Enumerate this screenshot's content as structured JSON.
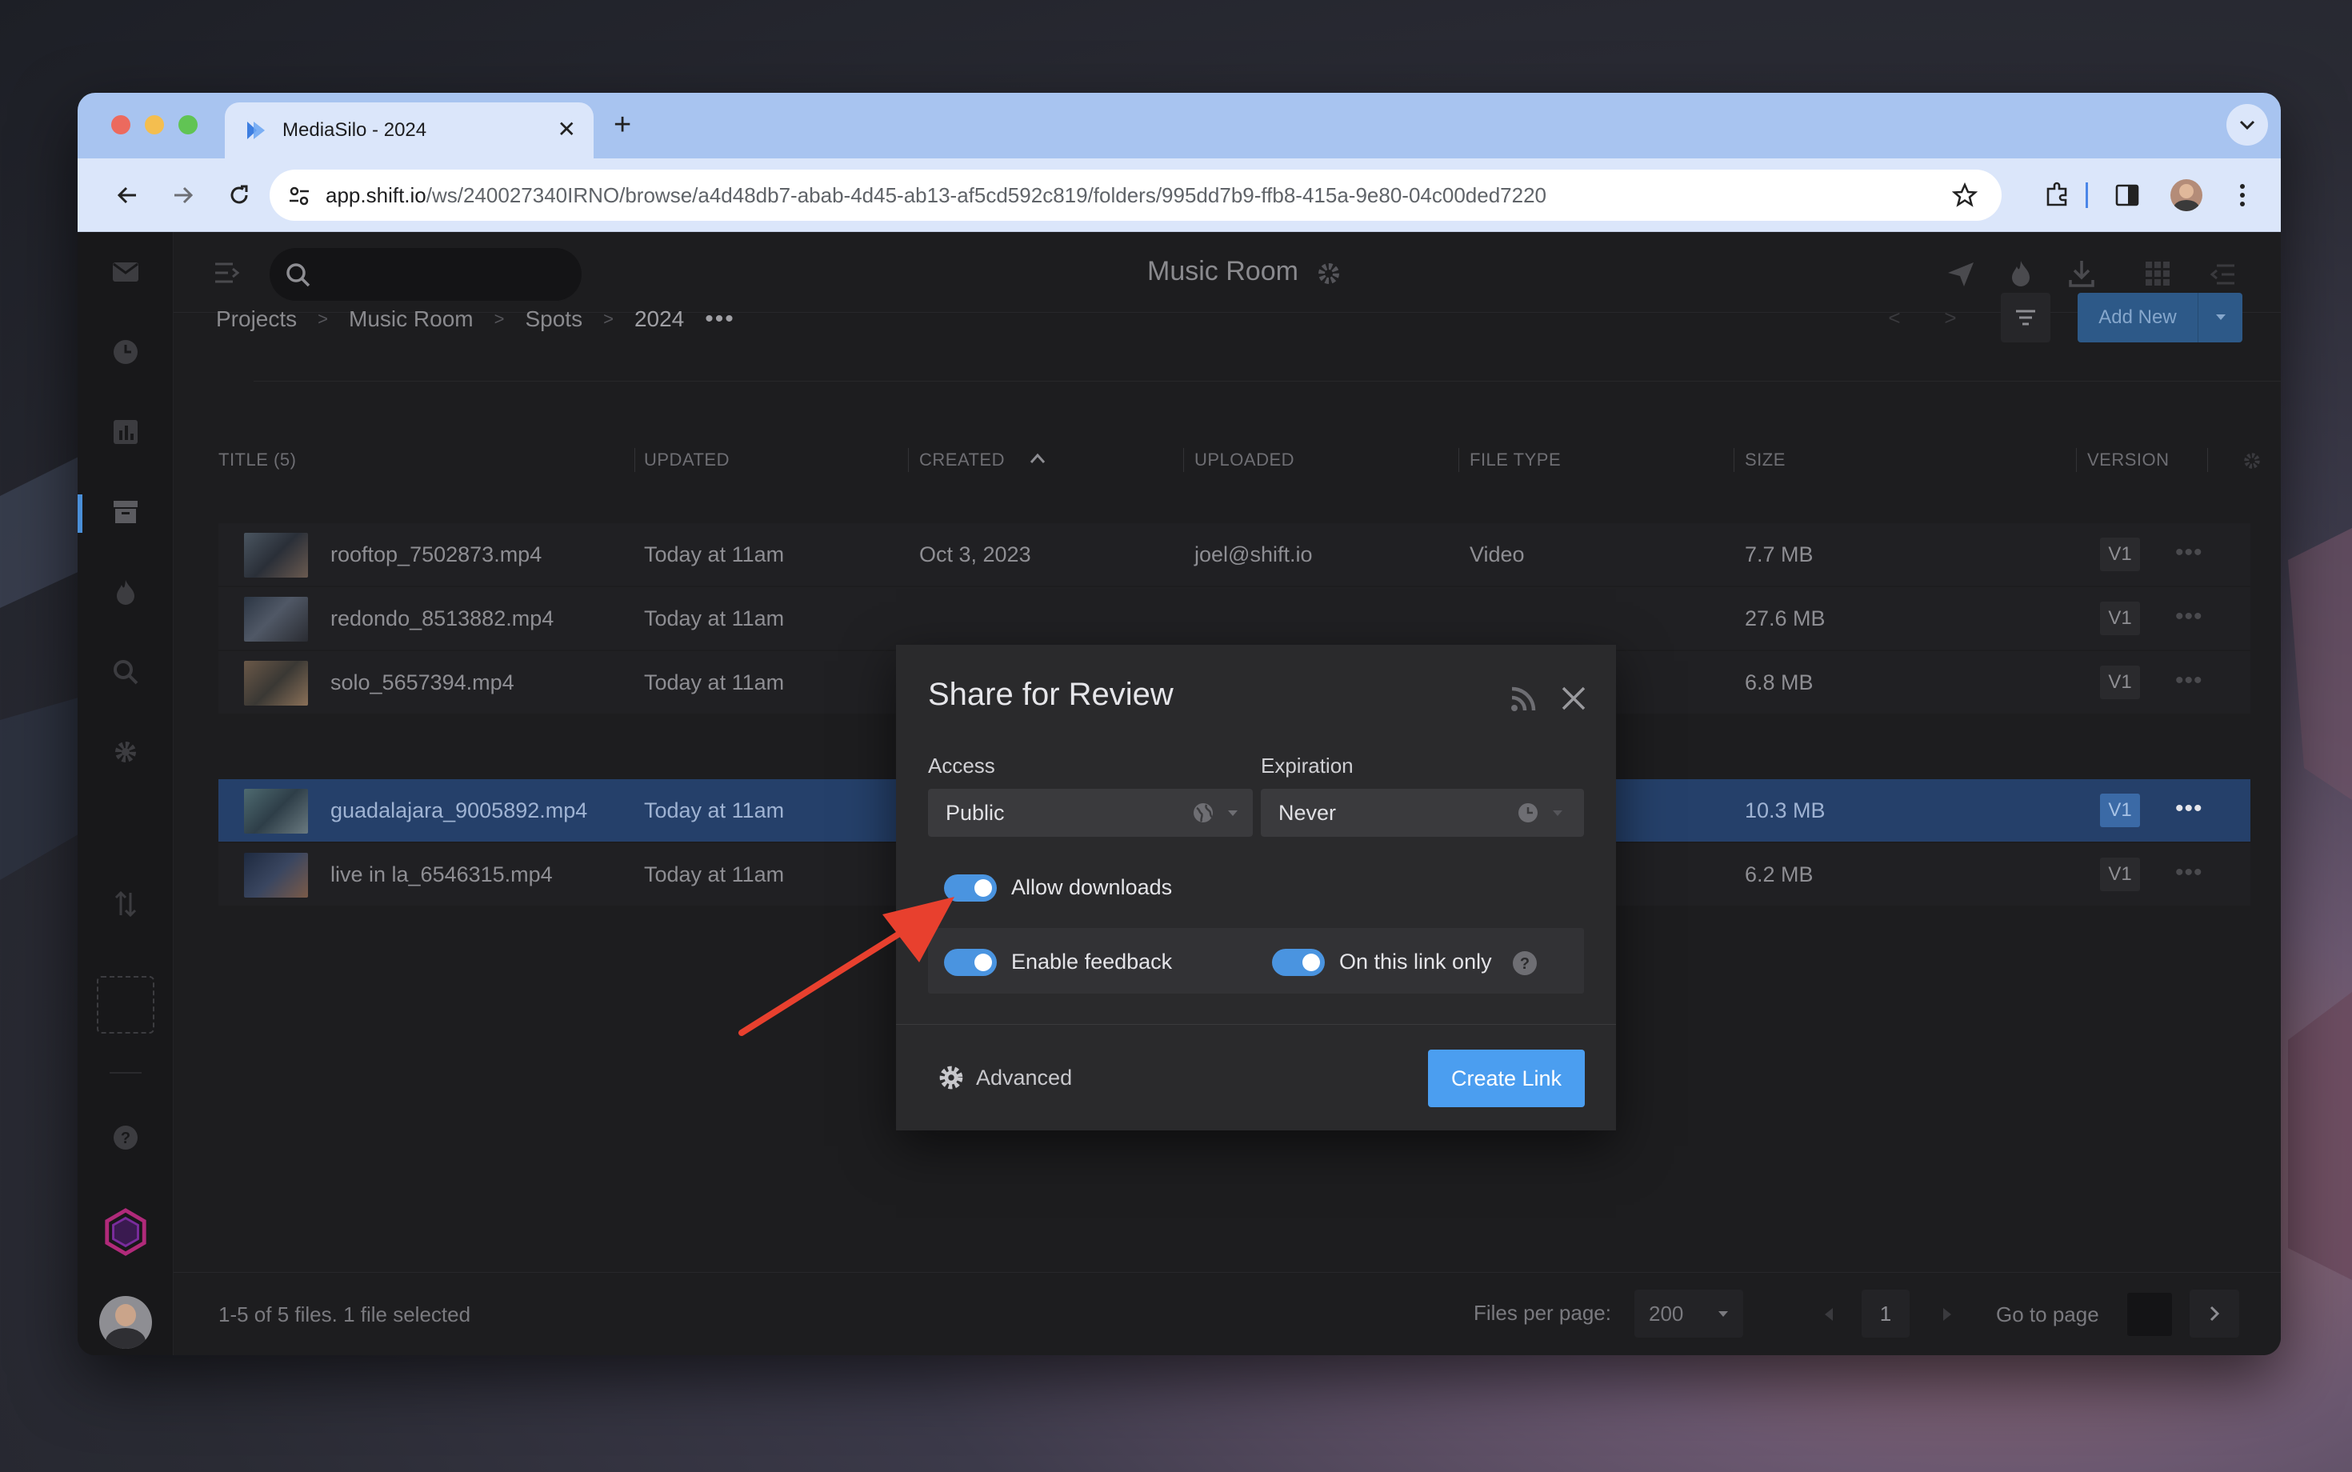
{
  "browser": {
    "tab_title": "MediaSilo - 2024",
    "url_host": "app.shift.io",
    "url_path": "/ws/240027340IRNO/browse/a4d48db7-abab-4d45-ab13-af5cd592c819/folders/995dd7b9-ffb8-415a-9e80-04c00ded7220"
  },
  "header": {
    "room_title": "Music Room"
  },
  "breadcrumb": [
    "Projects",
    "Music Room",
    "Spots",
    "2024"
  ],
  "toolbar": {
    "add_new_label": "Add New"
  },
  "table": {
    "columns": [
      "TITLE (5)",
      "UPDATED",
      "CREATED",
      "UPLOADED",
      "FILE TYPE",
      "SIZE",
      "VERSION"
    ],
    "rows": [
      {
        "title": "rooftop_7502873.mp4",
        "updated": "Today at 11am",
        "created": "Oct 3, 2023",
        "uploaded": "joel@shift.io",
        "type": "Video",
        "size": "7.7 MB",
        "version": "V1"
      },
      {
        "title": "redondo_8513882.mp4",
        "updated": "Today at 11am",
        "size": "27.6 MB",
        "version": "V1"
      },
      {
        "title": "solo_5657394.mp4",
        "updated": "Today at 11am",
        "size": "6.8 MB",
        "version": "V1"
      },
      {
        "title": "guadalajara_9005892.mp4",
        "updated": "Today at 11am",
        "size": "10.3 MB",
        "version": "V1"
      },
      {
        "title": "live in la_6546315.mp4",
        "updated": "Today at 11am",
        "size": "6.2 MB",
        "version": "V1"
      }
    ]
  },
  "footer": {
    "status": "1-5 of 5 files. 1 file selected",
    "per_page_label": "Files per page:",
    "per_page_value": "200",
    "page": "1",
    "goto_label": "Go to page"
  },
  "modal": {
    "title": "Share for Review",
    "access_label": "Access",
    "access_value": "Public",
    "expiration_label": "Expiration",
    "expiration_value": "Never",
    "allow_downloads_label": "Allow downloads",
    "enable_feedback_label": "Enable feedback",
    "link_only_label": "On this link only",
    "advanced_label": "Advanced",
    "create_label": "Create Link"
  },
  "colors": {
    "accent": "#4b9ef0",
    "selected_row": "#25406a",
    "arrow": "#e8402e"
  }
}
